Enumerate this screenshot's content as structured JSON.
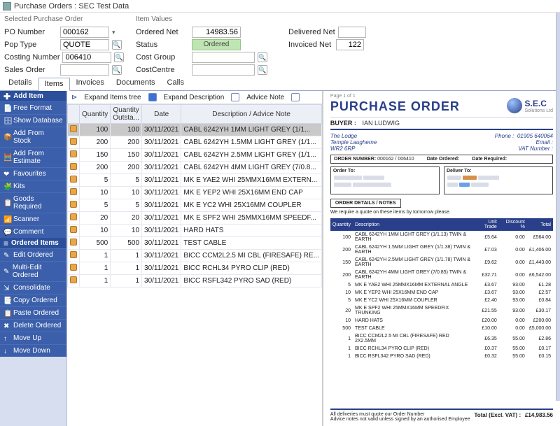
{
  "window": {
    "title": "Purchase Orders : SEC Test Data"
  },
  "top": {
    "selected_po": {
      "head": "Selected Purchase Order",
      "po_number_label": "PO Number",
      "po_number": "000162",
      "pop_type_label": "Pop Type",
      "pop_type": "QUOTE",
      "costing_label": "Costing Number",
      "costing": "006410",
      "sales_order_label": "Sales Order",
      "sales_order": ""
    },
    "item_values": {
      "head": "Item Values",
      "ordered_net_label": "Ordered Net",
      "ordered_net": "14983.56",
      "status_label": "Status",
      "status": "Ordered",
      "delivered_net_label": "Delivered Net",
      "delivered_net": "",
      "invoiced_net_label": "Invoiced Net",
      "invoiced_net": "122",
      "cost_group_label": "Cost Group",
      "cost_group": "",
      "cost_centre_label": "CostCentre",
      "cost_centre": ""
    }
  },
  "tabs": [
    "Details",
    "Items",
    "Invoices",
    "Documents",
    "Calls"
  ],
  "tabs_selected": 1,
  "sidebar": {
    "add_head": "Add Item",
    "add_items": [
      "Free Format",
      "Show Database",
      "Add From Stock",
      "Add From Estimate",
      "Favourites",
      "Kits",
      "Goods Required",
      "Scanner",
      "Comment"
    ],
    "ord_head": "Ordered Items",
    "ord_items": [
      "Edit Ordered",
      "Multi-Edit Ordered",
      "Consolidate",
      "Copy Ordered",
      "Paste Ordered",
      "Delete Ordered",
      "Move Up",
      "Move Down"
    ]
  },
  "grid": {
    "toolbar": {
      "expand_tree": "Expand Items tree",
      "expand_desc": "Expand Description",
      "advice_note": "Advice Note"
    },
    "cols": [
      "",
      "Quantity",
      "Quantity Outsta...",
      "Date",
      "Description / Advice Note"
    ],
    "rows": [
      {
        "sel": true,
        "qty": "100",
        "out": "100",
        "date": "30/11/2021",
        "desc": "CABL 6242YH 1MM LIGHT GREY (1/1..."
      },
      {
        "qty": "200",
        "out": "200",
        "date": "30/11/2021",
        "desc": "CABL 6242YH 1.5MM LIGHT GREY (1/1..."
      },
      {
        "qty": "150",
        "out": "150",
        "date": "30/11/2021",
        "desc": "CABL 6242YH 2.5MM LIGHT GREY (1/1..."
      },
      {
        "qty": "200",
        "out": "200",
        "date": "30/11/2021",
        "desc": "CABL 6242YH 4MM LIGHT GREY (7/0.8..."
      },
      {
        "qty": "5",
        "out": "5",
        "date": "30/11/2021",
        "desc": "MK E YAE2 WHI 25MMX16MM EXTERN..."
      },
      {
        "qty": "10",
        "out": "10",
        "date": "30/11/2021",
        "desc": "MK E YEP2 WHI 25X16MM END CAP"
      },
      {
        "qty": "5",
        "out": "5",
        "date": "30/11/2021",
        "desc": "MK E YC2 WHI 25X16MM COUPLER"
      },
      {
        "qty": "20",
        "out": "20",
        "date": "30/11/2021",
        "desc": "MK E SPF2 WHI 25MMX16MM SPEEDF..."
      },
      {
        "qty": "10",
        "out": "10",
        "date": "30/11/2021",
        "desc": "HARD HATS"
      },
      {
        "qty": "500",
        "out": "500",
        "date": "30/11/2021",
        "desc": "TEST CABLE"
      },
      {
        "qty": "1",
        "out": "1",
        "date": "30/11/2021",
        "desc": "BICC CCM2L2.5 MI CBL (FIRESAFE) RE..."
      },
      {
        "qty": "1",
        "out": "1",
        "date": "30/11/2021",
        "desc": "BICC RCHL34 PYRO CLIP (RED)"
      },
      {
        "qty": "1",
        "out": "1",
        "date": "30/11/2021",
        "desc": "BICC RSFL342 PYRO SAD (RED)"
      }
    ]
  },
  "doc": {
    "page": "Page 1 of 1",
    "title": "PURCHASE ORDER",
    "logo": "S.E.C",
    "logo_sub": "Solutions Ltd",
    "buyer_label": "BUYER :",
    "buyer": "IAN LUDWIG",
    "address": [
      "The Lodge",
      "Temple Laugherne",
      "WR2 6RP"
    ],
    "contacts": {
      "phone_label": "Phone :",
      "phone": "01905 640064",
      "email_label": "Email :",
      "vat_label": "VAT Number :"
    },
    "order_number_label": "ORDER NUMBER:",
    "order_number": "000162 / 006410",
    "date_ordered_label": "Date Ordered:",
    "date_required_label": "Date Required:",
    "order_to_label": "Order To:",
    "deliver_to_label": "Deliver To:",
    "order_details_label": "ORDER DETAILS / NOTES",
    "note": "We require a quote on these items by tomorrow please.",
    "cols": [
      "Quantity",
      "Description",
      "Unit Trade",
      "Discount %",
      "Total"
    ],
    "lines": [
      {
        "q": "100",
        "d": "CABL 6242YH 1MM LIGHT GREY (1/1.13) TWIN & EARTH",
        "u": "£5.64",
        "p": "0.00",
        "t": "£564.00"
      },
      {
        "q": "200",
        "d": "CABL 6242YH 1.5MM LIGHT GREY (1/1.38) TWIN & EARTH",
        "u": "£7.03",
        "p": "0.00",
        "t": "£1,406.00"
      },
      {
        "q": "150",
        "d": "CABL 6242YH 2.5MM LIGHT GREY (1/1.78) TWIN & EARTH",
        "u": "£9.62",
        "p": "0.00",
        "t": "£1,443.00"
      },
      {
        "q": "200",
        "d": "CABL 6242YH 4MM LIGHT GREY (7/0.85) TWIN & EARTH",
        "u": "£32.71",
        "p": "0.00",
        "t": "£6,542.00"
      },
      {
        "q": "5",
        "d": "MK E YAE2 WHI 25MMX16MM EXTERNAL ANGLE",
        "u": "£3.67",
        "p": "93.00",
        "t": "£1.28"
      },
      {
        "q": "10",
        "d": "MK E YEP2 WHI 25X16MM END CAP",
        "u": "£3.67",
        "p": "93.00",
        "t": "£2.57"
      },
      {
        "q": "5",
        "d": "MK E YC2 WHI 25X16MM COUPLER",
        "u": "£2.40",
        "p": "93.00",
        "t": "£0.84"
      },
      {
        "q": "20",
        "d": "MK E SPF2 WHI 25MMX16MM SPEEDFIX TRUNKING",
        "u": "£21.55",
        "p": "93.00",
        "t": "£30.17"
      },
      {
        "q": "10",
        "d": "HARD HATS",
        "u": "£20.00",
        "p": "0.00",
        "t": "£200.00"
      },
      {
        "q": "500",
        "d": "TEST CABLE",
        "u": "£10.00",
        "p": "0.00",
        "t": "£5,000.00"
      },
      {
        "q": "1",
        "d": "BICC CCM2L2.5 MI CBL (FIRESAFE) RED 2X2.5MM",
        "u": "£6.35",
        "p": "55.00",
        "t": "£2.86"
      },
      {
        "q": "1",
        "d": "BICC RCHL34 PYRO CLIP (RED)",
        "u": "£0.37",
        "p": "55.00",
        "t": "£0.17"
      },
      {
        "q": "1",
        "d": "BICC RSFL342 PYRO SAD (RED)",
        "u": "£0.32",
        "p": "55.00",
        "t": "£0.15"
      }
    ],
    "footer": {
      "line1": "All deliveries must quote our Order Number",
      "line2": "Advice notes not valid unless signed by an authorised Employee",
      "total_label": "Total (Excl. VAT) :",
      "total": "£14,983.56"
    }
  }
}
